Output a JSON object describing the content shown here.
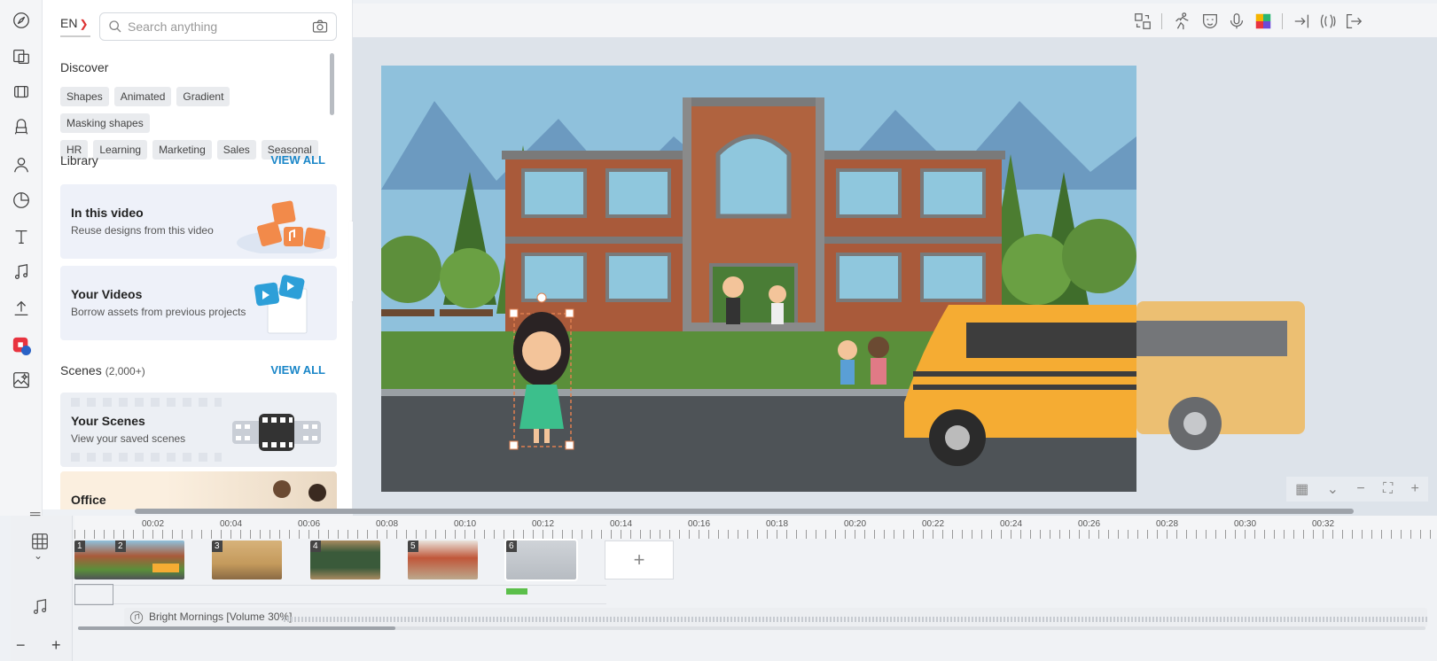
{
  "panel": {
    "language": "EN",
    "search_placeholder": "Search anything",
    "discover_heading": "Discover",
    "chips": [
      "Shapes",
      "Animated",
      "Gradient",
      "Masking shapes",
      "HR",
      "Learning",
      "Marketing",
      "Sales",
      "Seasonal"
    ],
    "library_heading": "Library",
    "library_view_all": "VIEW ALL",
    "cards": [
      {
        "title": "In this video",
        "subtitle": "Reuse designs from this video"
      },
      {
        "title": "Your Videos",
        "subtitle": "Borrow assets from previous projects"
      }
    ],
    "scenes_heading": "Scenes",
    "scenes_count": "(2,000+)",
    "scenes_view_all": "VIEW ALL",
    "scene_cards": [
      {
        "title": "Your Scenes",
        "subtitle": "View your saved scenes"
      },
      {
        "title": "Office",
        "subtitle": ""
      }
    ]
  },
  "timeline": {
    "ruler_labels": [
      "00:02",
      "00:04",
      "00:06",
      "00:08",
      "00:10",
      "00:12",
      "00:14",
      "00:16",
      "00:18",
      "00:20",
      "00:22",
      "00:24",
      "00:26",
      "00:28",
      "00:30",
      "00:32"
    ],
    "scenes": [
      {
        "num": "1"
      },
      {
        "num": "2"
      },
      {
        "num": "3"
      },
      {
        "num": "4"
      },
      {
        "num": "5"
      },
      {
        "num": "6"
      }
    ],
    "music_label": "Bright Mornings [Volume 30%]",
    "zoom_out": "−",
    "zoom_in": "+"
  },
  "colors": {
    "accent": "#1a86c8",
    "brand_red": "#e8333f"
  }
}
